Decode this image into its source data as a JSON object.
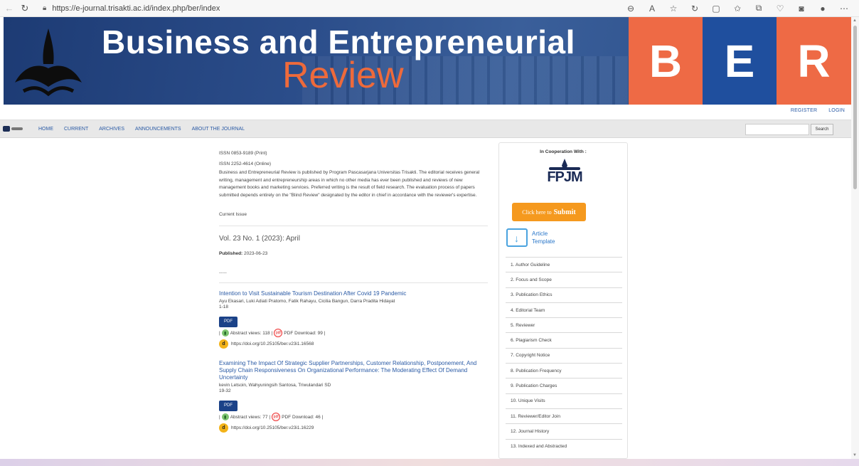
{
  "browser": {
    "url": "https://e-journal.trisakti.ac.id/index.php/ber/index"
  },
  "banner": {
    "title_line1": "Business and Entrepreneurial",
    "title_line2": "Review",
    "letters": [
      "B",
      "E",
      "R"
    ]
  },
  "userbar": {
    "register": "REGISTER",
    "login": "LOGIN"
  },
  "nav": {
    "items": [
      "HOME",
      "CURRENT",
      "ARCHIVES",
      "ANNOUNCEMENTS",
      "ABOUT THE JOURNAL"
    ],
    "search_button": "Search"
  },
  "main": {
    "issn_print": "ISSN 0853-9189 (Print)",
    "issn_online": "ISSN 2252-4614 (Online)",
    "description": "Business and Entrepreneurial Review is published by Program Pascasarjana Universitas Trisakti. The editorial receives general writing, management and entrepreneurship areas in which no other media has ever been published and reviews of new management books and marketing services. Preferred writing is the result of field research. The evaluation process of papers submitted depends entirely on the \"Blind Review\" designated by the editor in chief in accordance with the reviewer's expertise.",
    "current_issue_label": "Current Issue",
    "issue_title": "Vol. 23 No. 1 (2023): April",
    "published_label": "Published:",
    "published_date": "2023-06-23",
    "divider_text": "-----",
    "articles": [
      {
        "title": "Intention to Visit Sustainable Tourism Destination After Covid 19 Pandemic",
        "authors": "Ayu Ekasari, Luki Adiati Pratomo, Fatik Rahayu, Cicilia Bangun, Darra Pradita Hidayat",
        "pages": "1-18",
        "pdf": "PDF",
        "abstract_views": "Abstract views: 118",
        "pdf_downloads": "PDF Download: 99",
        "doi": "https://doi.org/10.25105/ber.v23i1.16568"
      },
      {
        "title": "Examining The Impact Of Strategic Supplier Partnerships, Customer Relationship, Postponement, And Supply Chain Responsiveness On Organizational Performance: The Moderating Effect Of Demand Uncertainty",
        "authors": "kevin Letsoin, Wahyuningsih Santosa, Triwulandari SD",
        "pages": "19-32",
        "pdf": "PDF",
        "abstract_views": "Abstract views: 77",
        "pdf_downloads": "PDF Download: 46",
        "doi": "https://doi.org/10.25105/ber.v23i1.16229"
      }
    ]
  },
  "sidebar": {
    "cooperation": "In Cooperation With :",
    "fpjm": "FPJM",
    "submit_prefix": "Click here to",
    "submit_bold": "Submit",
    "template_line1": "Article",
    "template_line2": "Template",
    "menu": [
      "1. Author Guideline",
      "2. Focus and Scope",
      "3. Publication Ethics",
      "4. Editorial Team",
      "5. Reviewer",
      "6. Plagiarism Check",
      "7. Copyright Notice",
      "8. Publication Frequency",
      "9. Publication Charges",
      "10. Unique Visits",
      "11. Reviewer/Editor Join",
      "12. Journal History",
      "13. Indexed and Abstracted"
    ]
  }
}
